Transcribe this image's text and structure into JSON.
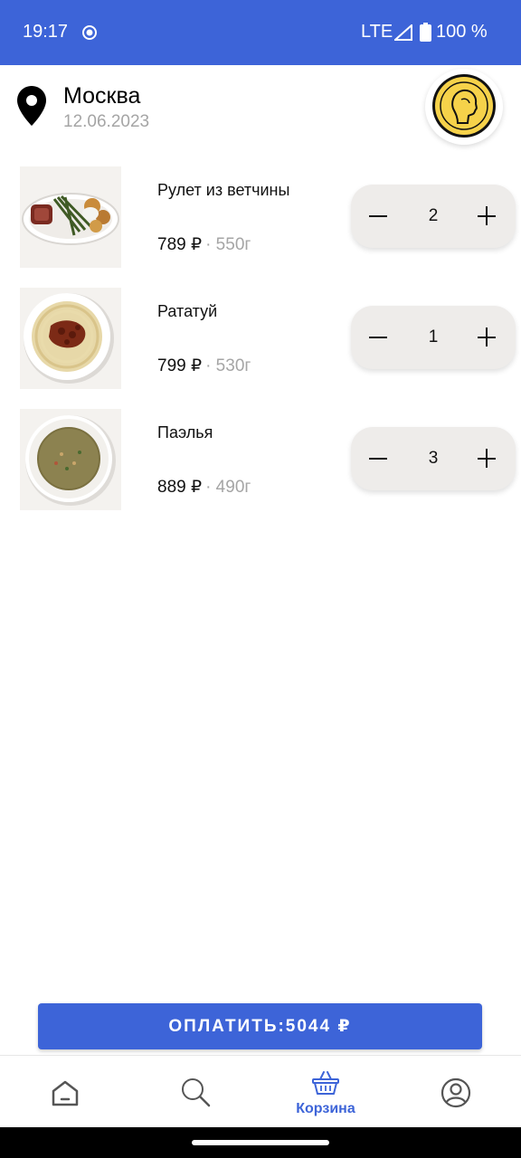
{
  "status_bar": {
    "time": "19:17",
    "network": "LTE",
    "battery": "100 %"
  },
  "header": {
    "city": "Москва",
    "date": "12.06.2023"
  },
  "cart": {
    "items": [
      {
        "name": "Рулет из ветчины",
        "price": "789 ₽",
        "weight": "· 550г",
        "quantity": "2"
      },
      {
        "name": "Рататуй",
        "price": "799 ₽",
        "weight": "· 530г",
        "quantity": "1"
      },
      {
        "name": "Паэлья",
        "price": "889 ₽",
        "weight": "· 490г",
        "quantity": "3"
      }
    ]
  },
  "pay_button": {
    "label": "ОПЛАТИТЬ:5044 ₽"
  },
  "bottom_nav": {
    "items": [
      {
        "icon": "home-icon",
        "label": ""
      },
      {
        "icon": "search-icon",
        "label": ""
      },
      {
        "icon": "basket-icon",
        "label": "Корзина",
        "active": true
      },
      {
        "icon": "profile-icon",
        "label": ""
      }
    ]
  },
  "colors": {
    "accent": "#3d64d8",
    "secondary_text": "#a5a5a5",
    "stepper_bg": "#eeecea"
  }
}
